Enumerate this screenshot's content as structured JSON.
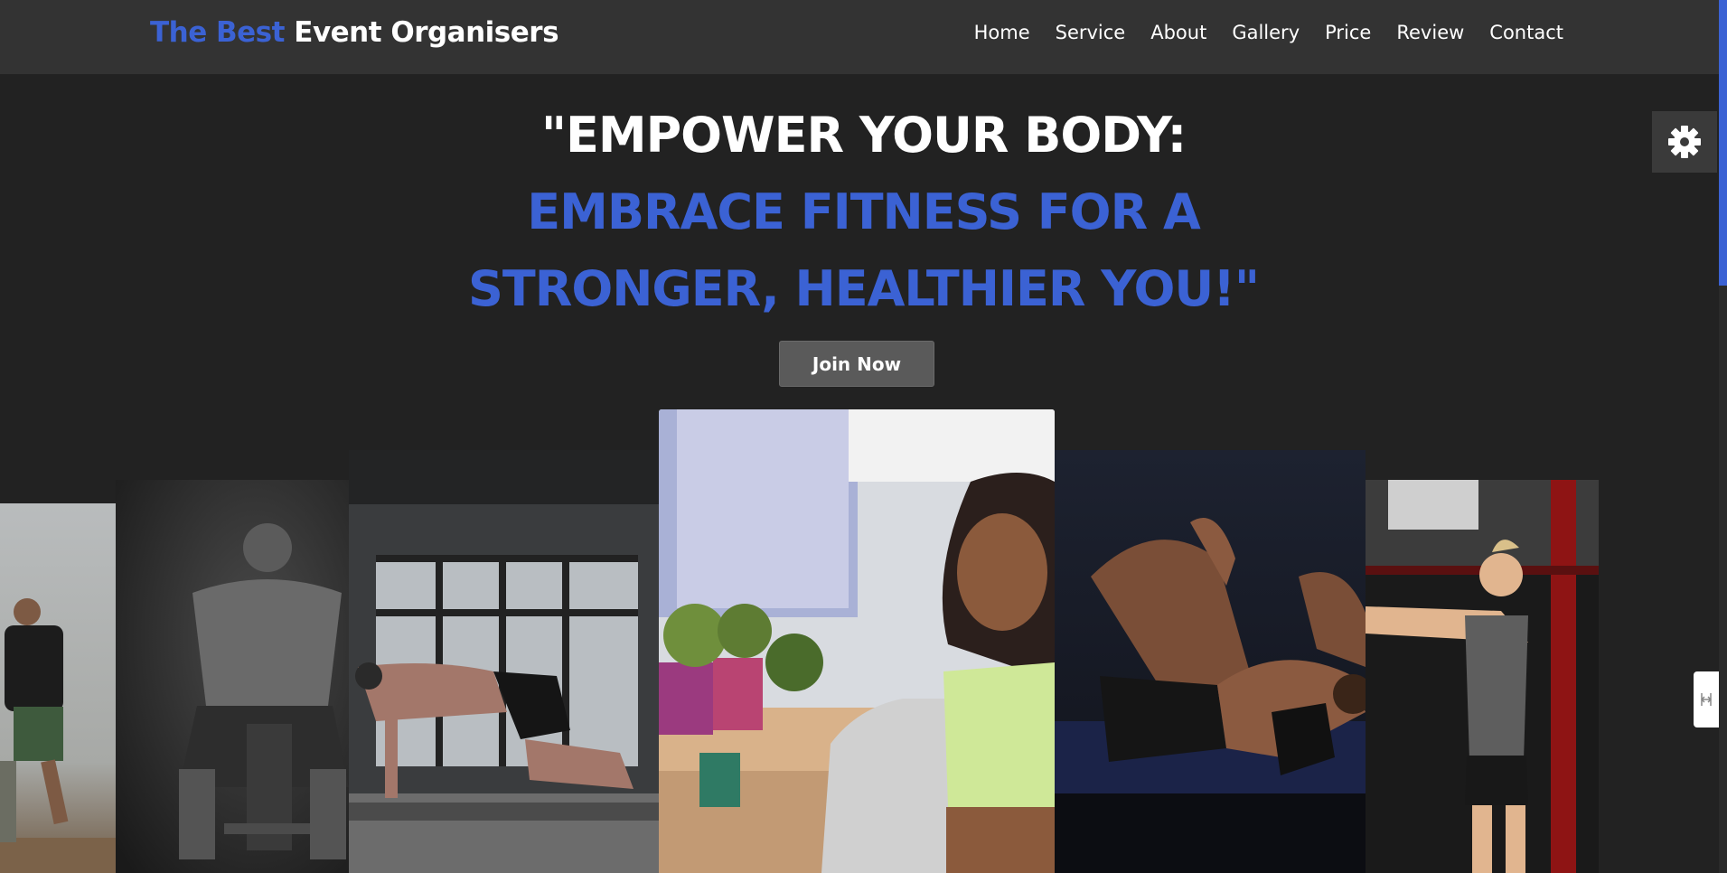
{
  "header": {
    "logo_accent": "The Best",
    "logo_rest": "Event Organisers",
    "nav": [
      "Home",
      "Service",
      "About",
      "Gallery",
      "Price",
      "Review",
      "Contact"
    ]
  },
  "hero": {
    "line1": "\"EMPOWER YOUR BODY:",
    "line2": "EMBRACE FITNESS FOR A",
    "line3": "STRONGER, HEALTHIER YOU!\"",
    "button_label": "Join Now"
  },
  "icons": {
    "settings": "gear-icon",
    "side_tab": "expand-icon"
  },
  "colors": {
    "accent": "#3b62d4",
    "header_bg": "#333333",
    "page_bg": "#222222",
    "button_bg": "#5a5a5a"
  }
}
